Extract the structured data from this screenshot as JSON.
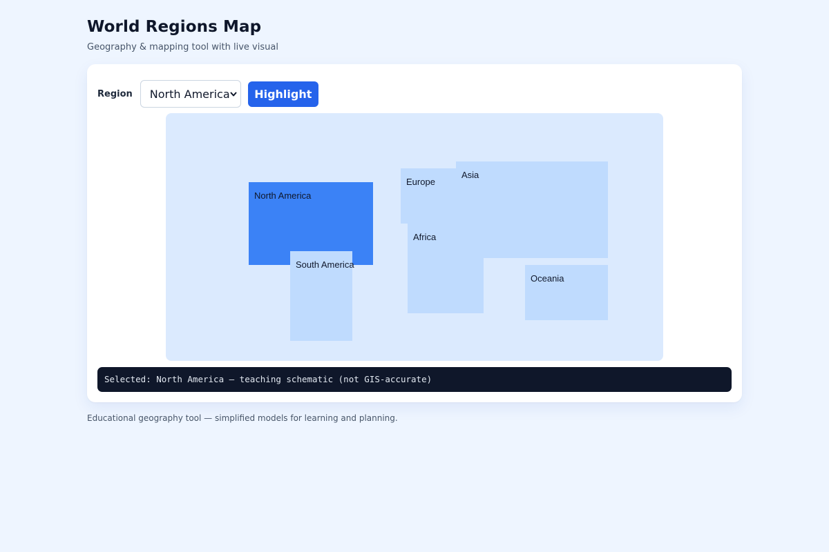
{
  "header": {
    "title": "World Regions Map",
    "subtitle": "Geography & mapping tool with live visual"
  },
  "controls": {
    "region_label": "Region",
    "selected_region": "North America",
    "highlight_label": "Highlight"
  },
  "map": {
    "selected": "North America",
    "colors": {
      "background": "#dbeafe",
      "region": "#bfdbfe",
      "selected": "#3b82f6"
    },
    "regions": [
      {
        "name": "North America"
      },
      {
        "name": "South America"
      },
      {
        "name": "Europe"
      },
      {
        "name": "Asia"
      },
      {
        "name": "Africa"
      },
      {
        "name": "Oceania"
      }
    ]
  },
  "status": {
    "text": "Selected: North America — teaching schematic (not GIS-accurate)"
  },
  "footer": {
    "note": "Educational geography tool — simplified models for learning and planning."
  }
}
